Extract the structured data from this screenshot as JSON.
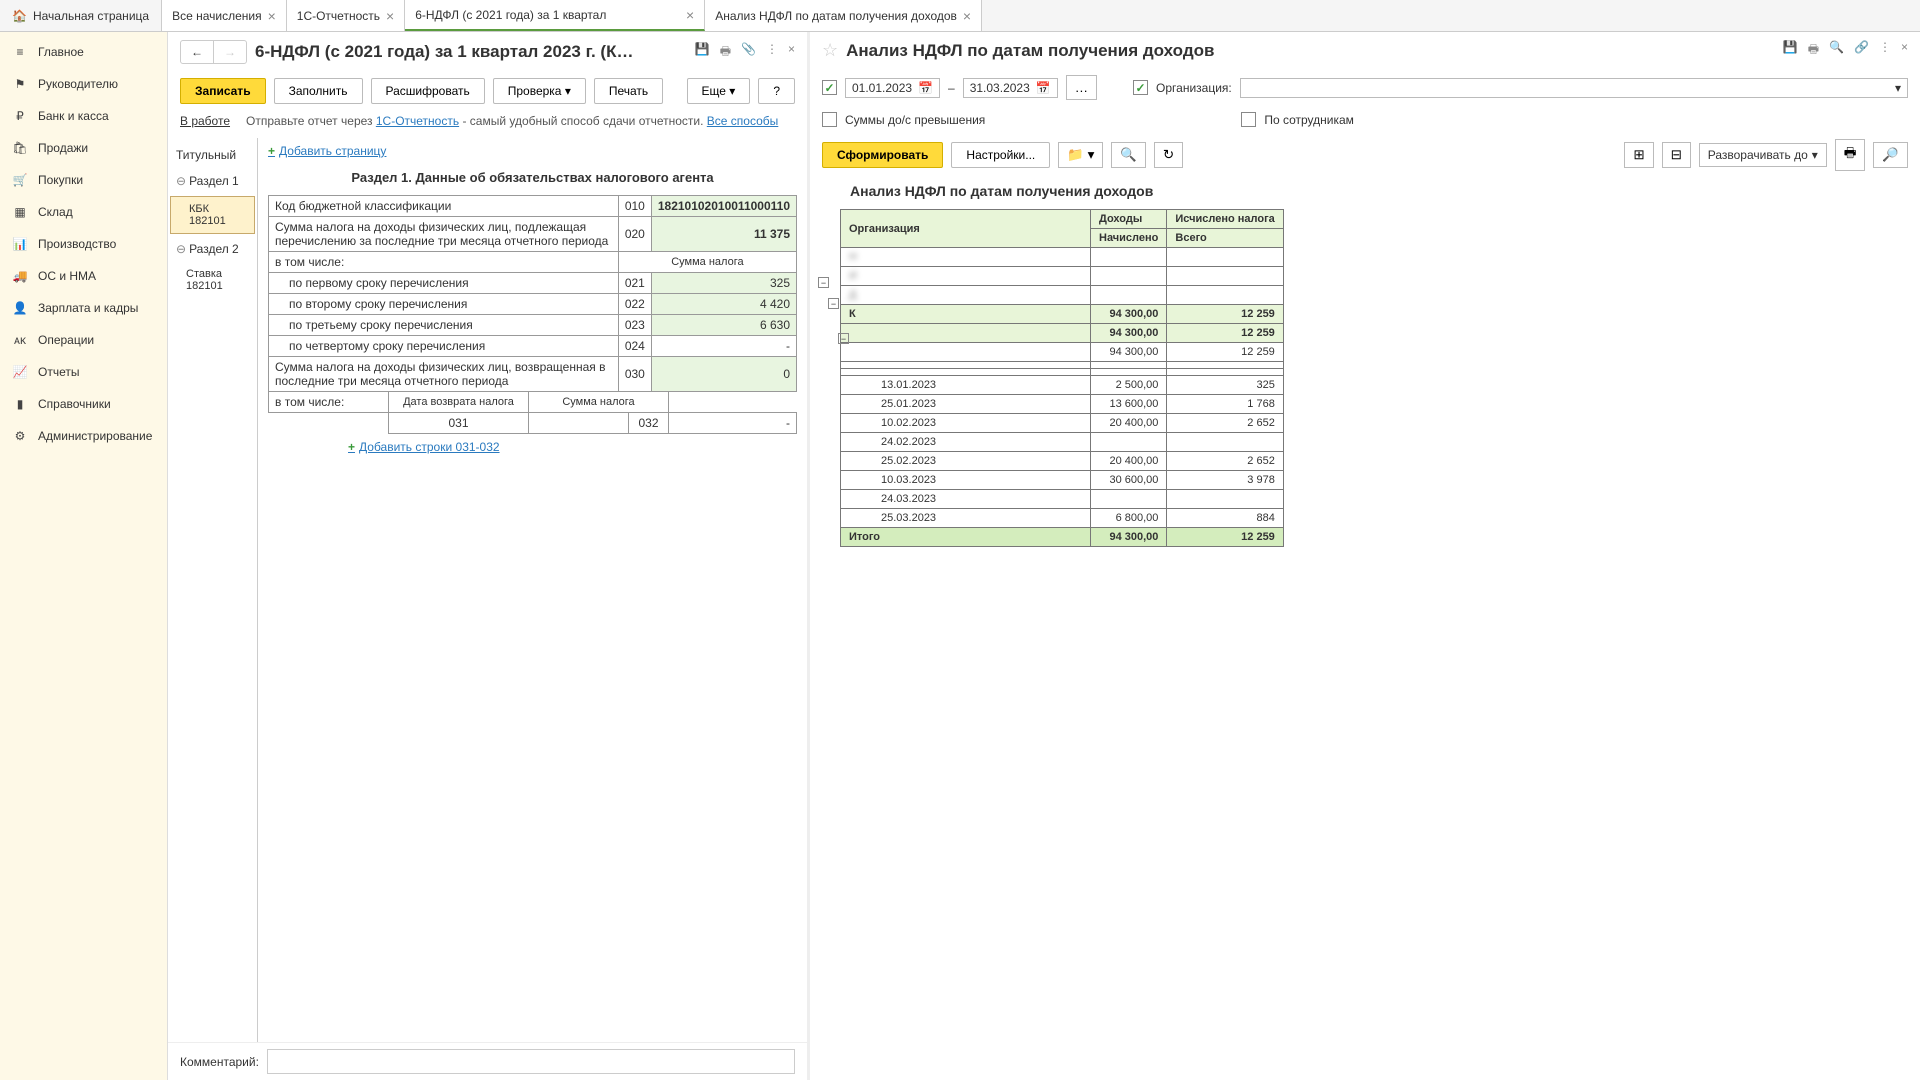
{
  "tabs": {
    "home": "Начальная страница",
    "items": [
      "Все начисления",
      "1С-Отчетность",
      "6-НДФЛ (с 2021 года) за 1 квартал",
      "Анализ НДФЛ по датам получения доходов"
    ]
  },
  "sidebar": [
    {
      "icon": "menu",
      "label": "Главное"
    },
    {
      "icon": "flag",
      "label": "Руководителю"
    },
    {
      "icon": "bank",
      "label": "Банк и касса"
    },
    {
      "icon": "cart",
      "label": "Продажи"
    },
    {
      "icon": "basket",
      "label": "Покупки"
    },
    {
      "icon": "box",
      "label": "Склад"
    },
    {
      "icon": "chart",
      "label": "Производство"
    },
    {
      "icon": "truck",
      "label": "ОС и НМА"
    },
    {
      "icon": "person",
      "label": "Зарплата и кадры"
    },
    {
      "icon": "ops",
      "label": "Операции"
    },
    {
      "icon": "report",
      "label": "Отчеты"
    },
    {
      "icon": "book",
      "label": "Справочники"
    },
    {
      "icon": "gear",
      "label": "Администрирование"
    }
  ],
  "left": {
    "title": "6-НДФЛ (с 2021 года) за 1 квартал 2023 г. (К…",
    "buttons": {
      "save": "Записать",
      "fill": "Заполнить",
      "decode": "Расшифровать",
      "check": "Проверка",
      "print": "Печать",
      "more": "Еще",
      "help": "?"
    },
    "status": "В работе",
    "info_prefix": "Отправьте отчет через ",
    "info_link1": "1С-Отчетность",
    "info_mid": " - самый удобный способ сдачи отчетности. ",
    "info_link2": "Все способы",
    "add_page": "Добавить страницу",
    "page_tabs": {
      "title": "Титульный",
      "s1": "Раздел 1",
      "kbk": "КБК",
      "kbk_v": "182101",
      "s2": "Раздел 2",
      "rate": "Ставка",
      "rate_v": "182101"
    },
    "section_title": "Раздел 1. Данные об обязательствах налогового агента",
    "rows": {
      "kbk_label": "Код бюджетной классификации",
      "kbk_code": "010",
      "kbk_val": "18210102010011000110",
      "sum_label": "Сумма налога на доходы физических лиц, подлежащая перечислению за последние три месяца отчетного периода",
      "sum_code": "020",
      "sum_val": "11 375",
      "including": "в том числе:",
      "sum_tax": "Сумма налога",
      "t1": "по первому сроку перечисления",
      "t1c": "021",
      "t1v": "325",
      "t2": "по второму сроку перечисления",
      "t2c": "022",
      "t2v": "4 420",
      "t3": "по третьему сроку перечисления",
      "t3c": "023",
      "t3v": "6 630",
      "t4": "по четвертому сроку перечисления",
      "t4c": "024",
      "t4v": "-",
      "ret_label": "Сумма налога на доходы физических лиц, возвращенная в последние три месяца отчетного периода",
      "ret_code": "030",
      "ret_val": "0",
      "ret_date": "Дата возврата налога",
      "r031": "031",
      "r032": "032",
      "dash": "-",
      "add_rows": "Добавить строки 031-032"
    },
    "comment_label": "Комментарий:"
  },
  "right": {
    "title": "Анализ НДФЛ по датам получения доходов",
    "date_from": "01.01.2023",
    "date_to": "31.03.2023",
    "dash": "–",
    "org_label": "Организация:",
    "sums_ds": "Суммы до/с превышения",
    "by_emp": "По сотрудникам",
    "btn_form": "Сформировать",
    "btn_settings": "Настройки...",
    "btn_expand": "Разворачивать до",
    "report_title": "Анализ НДФЛ по датам получения доходов",
    "headers": {
      "org": "Организация",
      "inc": "Доходы",
      "tax": "Исчислено налога",
      "nach": "Начислено",
      "total": "Всего"
    },
    "stub": {
      "a": "Н",
      "b": "И",
      "c": "Д",
      "d": "К"
    },
    "rows": [
      {
        "d": "",
        "inc": "94 300,00",
        "tax": "12 259",
        "bold": true
      },
      {
        "d": "",
        "inc": "94 300,00",
        "tax": "12 259",
        "sub": true
      },
      {
        "d": "",
        "inc": "94 300,00",
        "tax": "12 259"
      },
      {
        "d": "",
        "inc": "",
        "tax": ""
      },
      {
        "d": "",
        "inc": "",
        "tax": ""
      },
      {
        "d": "13.01.2023",
        "inc": "2 500,00",
        "tax": "325"
      },
      {
        "d": "25.01.2023",
        "inc": "13 600,00",
        "tax": "1 768"
      },
      {
        "d": "10.02.2023",
        "inc": "20 400,00",
        "tax": "2 652"
      },
      {
        "d": "24.02.2023",
        "inc": "",
        "tax": ""
      },
      {
        "d": "25.02.2023",
        "inc": "20 400,00",
        "tax": "2 652"
      },
      {
        "d": "10.03.2023",
        "inc": "30 600,00",
        "tax": "3 978"
      },
      {
        "d": "24.03.2023",
        "inc": "",
        "tax": ""
      },
      {
        "d": "25.03.2023",
        "inc": "6 800,00",
        "tax": "884"
      }
    ],
    "total": {
      "label": "Итого",
      "inc": "94 300,00",
      "tax": "12 259"
    },
    "ellipsis": "…"
  }
}
